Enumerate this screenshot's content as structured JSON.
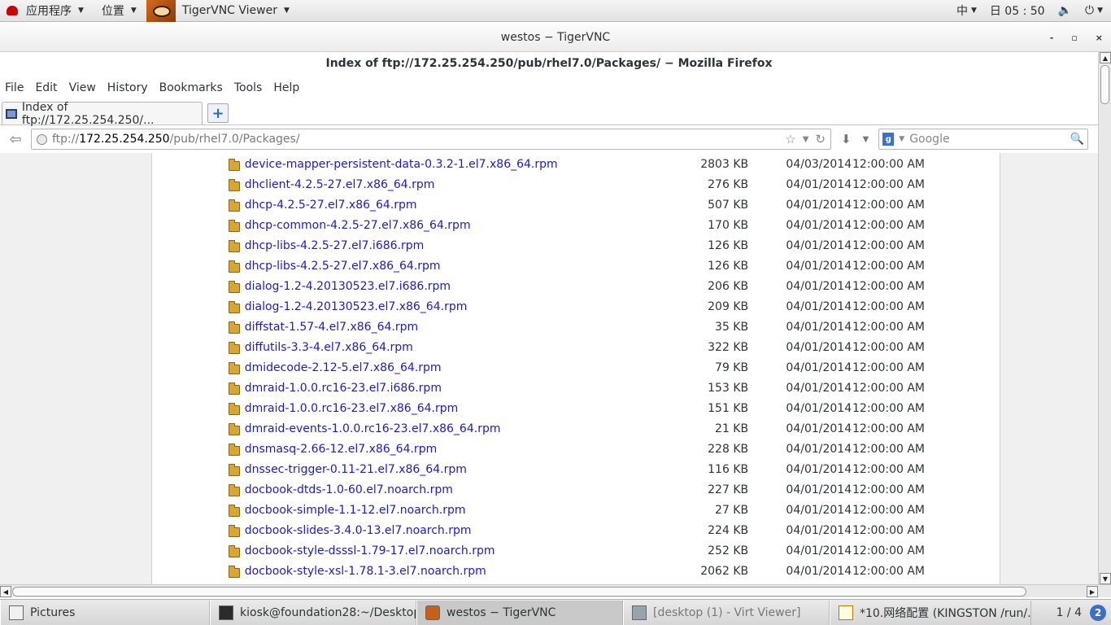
{
  "top_panel": {
    "applications": "应用程序",
    "places": "位置",
    "active_app": "TigerVNC Viewer",
    "input_method": "中",
    "clock": "日 05 : 50"
  },
  "vnc_window": {
    "title": "westos − TigerVNC",
    "minimize": "-",
    "maximize": "▫",
    "close": "×"
  },
  "firefox": {
    "window_title": "Index of ftp://172.25.254.250/pub/rhel7.0/Packages/ − Mozilla Firefox",
    "menu": [
      {
        "label": "File"
      },
      {
        "label": "Edit"
      },
      {
        "label": "View"
      },
      {
        "label": "History"
      },
      {
        "label": "Bookmarks"
      },
      {
        "label": "Tools"
      },
      {
        "label": "Help"
      }
    ],
    "tab_title": "Index of ftp://172.25.254.250/...",
    "url": {
      "scheme": "ftp://",
      "host": "172.25.254.250",
      "path": "/pub/rhel7.0/Packages/"
    },
    "search_placeholder": "Google"
  },
  "files": [
    {
      "name": "device-mapper-persistent-data-0.3.2-1.el7.x86_64.rpm",
      "size": "2803 KB",
      "date": "04/03/2014",
      "time": "12:00:00 AM"
    },
    {
      "name": "dhclient-4.2.5-27.el7.x86_64.rpm",
      "size": "276 KB",
      "date": "04/01/2014",
      "time": "12:00:00 AM"
    },
    {
      "name": "dhcp-4.2.5-27.el7.x86_64.rpm",
      "size": "507 KB",
      "date": "04/01/2014",
      "time": "12:00:00 AM"
    },
    {
      "name": "dhcp-common-4.2.5-27.el7.x86_64.rpm",
      "size": "170 KB",
      "date": "04/01/2014",
      "time": "12:00:00 AM"
    },
    {
      "name": "dhcp-libs-4.2.5-27.el7.i686.rpm",
      "size": "126 KB",
      "date": "04/01/2014",
      "time": "12:00:00 AM"
    },
    {
      "name": "dhcp-libs-4.2.5-27.el7.x86_64.rpm",
      "size": "126 KB",
      "date": "04/01/2014",
      "time": "12:00:00 AM"
    },
    {
      "name": "dialog-1.2-4.20130523.el7.i686.rpm",
      "size": "206 KB",
      "date": "04/01/2014",
      "time": "12:00:00 AM"
    },
    {
      "name": "dialog-1.2-4.20130523.el7.x86_64.rpm",
      "size": "209 KB",
      "date": "04/01/2014",
      "time": "12:00:00 AM"
    },
    {
      "name": "diffstat-1.57-4.el7.x86_64.rpm",
      "size": "35 KB",
      "date": "04/01/2014",
      "time": "12:00:00 AM"
    },
    {
      "name": "diffutils-3.3-4.el7.x86_64.rpm",
      "size": "322 KB",
      "date": "04/01/2014",
      "time": "12:00:00 AM"
    },
    {
      "name": "dmidecode-2.12-5.el7.x86_64.rpm",
      "size": "79 KB",
      "date": "04/01/2014",
      "time": "12:00:00 AM"
    },
    {
      "name": "dmraid-1.0.0.rc16-23.el7.i686.rpm",
      "size": "153 KB",
      "date": "04/01/2014",
      "time": "12:00:00 AM"
    },
    {
      "name": "dmraid-1.0.0.rc16-23.el7.x86_64.rpm",
      "size": "151 KB",
      "date": "04/01/2014",
      "time": "12:00:00 AM"
    },
    {
      "name": "dmraid-events-1.0.0.rc16-23.el7.x86_64.rpm",
      "size": "21 KB",
      "date": "04/01/2014",
      "time": "12:00:00 AM"
    },
    {
      "name": "dnsmasq-2.66-12.el7.x86_64.rpm",
      "size": "228 KB",
      "date": "04/01/2014",
      "time": "12:00:00 AM"
    },
    {
      "name": "dnssec-trigger-0.11-21.el7.x86_64.rpm",
      "size": "116 KB",
      "date": "04/01/2014",
      "time": "12:00:00 AM"
    },
    {
      "name": "docbook-dtds-1.0-60.el7.noarch.rpm",
      "size": "227 KB",
      "date": "04/01/2014",
      "time": "12:00:00 AM"
    },
    {
      "name": "docbook-simple-1.1-12.el7.noarch.rpm",
      "size": "27 KB",
      "date": "04/01/2014",
      "time": "12:00:00 AM"
    },
    {
      "name": "docbook-slides-3.4.0-13.el7.noarch.rpm",
      "size": "224 KB",
      "date": "04/01/2014",
      "time": "12:00:00 AM"
    },
    {
      "name": "docbook-style-dsssl-1.79-17.el7.noarch.rpm",
      "size": "252 KB",
      "date": "04/01/2014",
      "time": "12:00:00 AM"
    },
    {
      "name": "docbook-style-xsl-1.78.1-3.el7.noarch.rpm",
      "size": "2062 KB",
      "date": "04/01/2014",
      "time": "12:00:00 AM"
    }
  ],
  "taskbar": {
    "tasks": [
      {
        "label": "Pictures"
      },
      {
        "label": "kiosk@foundation28:~/Desktop"
      },
      {
        "label": "westos − TigerVNC"
      },
      {
        "label": "[desktop (1) - Virt Viewer]"
      },
      {
        "label": "*10.网络配置 (KINGSTON /run/…"
      }
    ],
    "workspace": "1 / 4",
    "notifications": "2"
  }
}
